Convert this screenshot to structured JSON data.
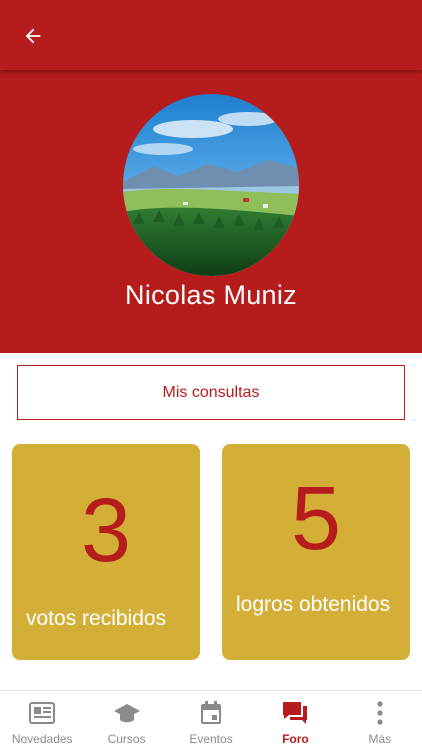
{
  "app": {
    "accent_color": "#b71c1c",
    "card_color": "#d4af37",
    "back_icon": "arrow-left-icon"
  },
  "profile": {
    "name": "Nicolas Muniz",
    "avatar": "landscape-photo"
  },
  "consultas_button": {
    "label": "Mis consultas"
  },
  "stats": [
    {
      "value": "3",
      "label": "votos recibidos"
    },
    {
      "value": "5",
      "label": "logros obtenidos"
    }
  ],
  "bottom_nav": {
    "items": [
      {
        "label": "Novedades",
        "icon": "newspaper-icon",
        "active": false
      },
      {
        "label": "Cursos",
        "icon": "graduation-cap-icon",
        "active": false
      },
      {
        "label": "Eventos",
        "icon": "calendar-icon",
        "active": false
      },
      {
        "label": "Foro",
        "icon": "forum-icon",
        "active": true
      },
      {
        "label": "Más",
        "icon": "more-vertical-icon",
        "active": false
      }
    ]
  }
}
